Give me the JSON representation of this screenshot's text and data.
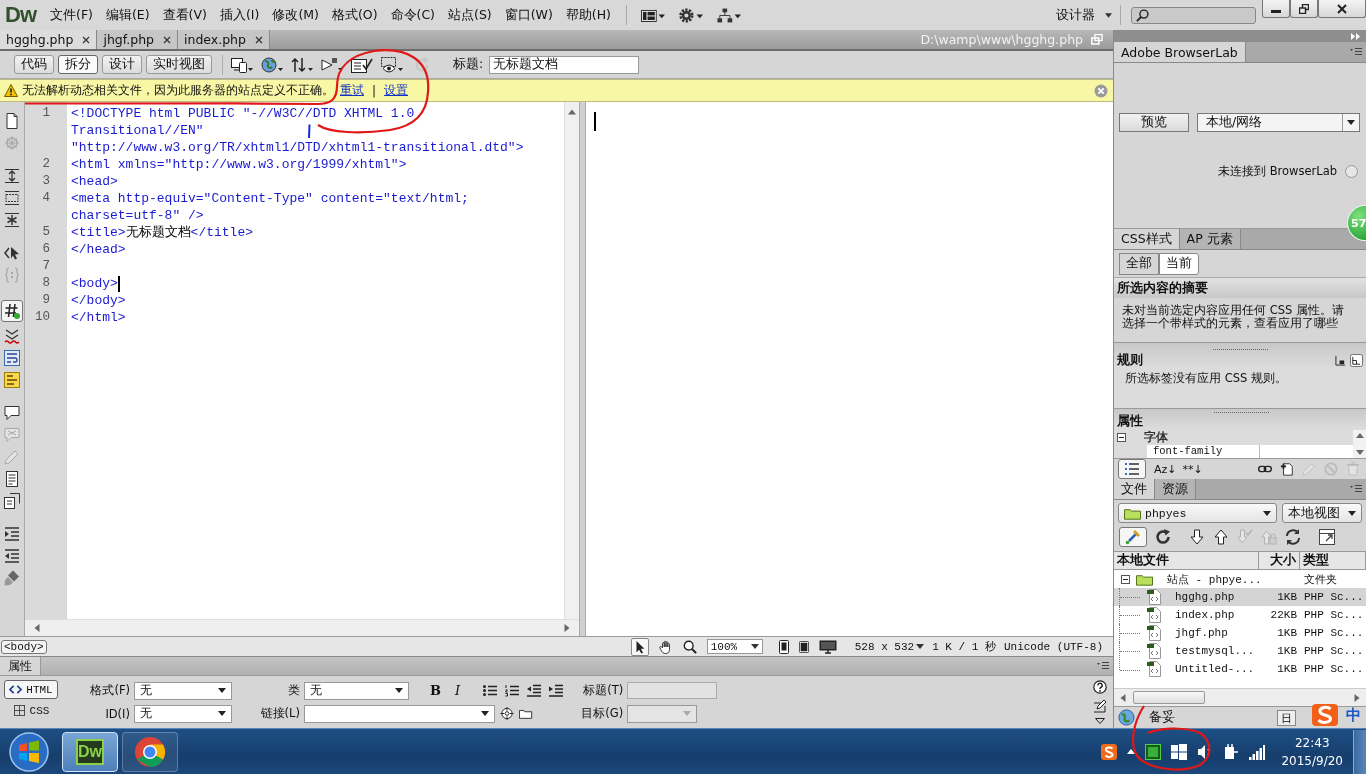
{
  "menu_bar": {
    "logo": "Dw",
    "menus": [
      "文件(F)",
      "编辑(E)",
      "查看(V)",
      "插入(I)",
      "修改(M)",
      "格式(O)",
      "命令(C)",
      "站点(S)",
      "窗口(W)",
      "帮助(H)"
    ],
    "workspace": "设计器"
  },
  "document_tabs": [
    {
      "label": "hgghg.php",
      "selected": true
    },
    {
      "label": "jhgf.php",
      "selected": false
    },
    {
      "label": "index.php",
      "selected": false
    }
  ],
  "file_path": "D:\\wamp\\www\\hgghg.php",
  "document_toolbar": {
    "views": [
      {
        "label": "代码",
        "selected": false
      },
      {
        "label": "拆分",
        "selected": true
      },
      {
        "label": "设计",
        "selected": false
      },
      {
        "label": "实时视图",
        "selected": false
      }
    ],
    "tools": [
      {
        "kind": "devices",
        "disabled": false
      },
      {
        "kind": "globe",
        "disabled": false
      },
      {
        "kind": "transfer",
        "disabled": false
      },
      {
        "kind": "debug",
        "disabled": false
      },
      {
        "kind": "validate",
        "disabled": false
      },
      {
        "kind": "visual",
        "disabled": false
      },
      {
        "kind": "refresh",
        "disabled": true
      }
    ],
    "title_label": "标题:",
    "title_value": "无标题文档"
  },
  "warning": {
    "message": "无法解析动态相关文件，因为此服务器的站点定义不正确。",
    "links": [
      "重试",
      "设置"
    ],
    "separator": "|"
  },
  "coding_toolbar": [
    {
      "kind": "documents",
      "on": false,
      "disabled": false
    },
    {
      "kind": "wheel",
      "on": false,
      "disabled": true
    },
    {
      "kind": "collapse",
      "on": false,
      "disabled": false
    },
    {
      "kind": "selection",
      "on": false,
      "disabled": false
    },
    {
      "kind": "expand",
      "on": false,
      "disabled": false
    },
    {
      "kind": "parent",
      "on": false,
      "disabled": false
    },
    {
      "kind": "braces",
      "on": false,
      "disabled": true
    },
    {
      "kind": "numbers",
      "on": true,
      "disabled": false
    },
    {
      "kind": "invalid",
      "on": false,
      "disabled": false
    },
    {
      "kind": "wrap",
      "on": false,
      "disabled": false
    },
    {
      "kind": "syntax",
      "on": false,
      "disabled": false
    },
    {
      "kind": "comment",
      "on": false,
      "disabled": false
    },
    {
      "kind": "uncomment",
      "on": false,
      "disabled": true
    },
    {
      "kind": "wraptag",
      "on": false,
      "disabled": true
    },
    {
      "kind": "snippets",
      "on": false,
      "disabled": false
    },
    {
      "kind": "move",
      "on": false,
      "disabled": false
    },
    {
      "kind": "indent",
      "on": false,
      "disabled": false
    },
    {
      "kind": "outdent",
      "on": false,
      "disabled": false
    },
    {
      "kind": "format",
      "on": false,
      "disabled": false
    }
  ],
  "code": [
    {
      "number": "1",
      "caret": false,
      "rows": [
        "<!DOCTYPE html PUBLIC \"-//W3C//DTD XHTML 1.0",
        "Transitional//EN\"",
        "\"http://www.w3.org/TR/xhtml1/DTD/xhtml1-transitional.dtd\">"
      ]
    },
    {
      "number": "2",
      "caret": false,
      "rows": [
        "<html xmlns=\"http://www.w3.org/1999/xhtml\">"
      ]
    },
    {
      "number": "3",
      "caret": false,
      "rows": [
        "<head>"
      ]
    },
    {
      "number": "4",
      "caret": false,
      "rows": [
        "<meta http-equiv=\"Content-Type\" content=\"text/html;",
        "charset=utf-8\" />"
      ]
    },
    {
      "number": "5",
      "caret": false,
      "rows": [
        [
          {
            "kind": "tag",
            "text": "<title>"
          },
          {
            "kind": "text",
            "text": "无标题文档"
          },
          {
            "kind": "tag",
            "text": "</title>"
          }
        ]
      ]
    },
    {
      "number": "6",
      "caret": false,
      "rows": [
        "</head>"
      ]
    },
    {
      "number": "7",
      "caret": false
    },
    {
      "number": "8",
      "caret": true,
      "rows": [
        "<body>"
      ]
    },
    {
      "number": "9",
      "caret": false,
      "rows": [
        "</body>"
      ]
    },
    {
      "number": "10",
      "caret": false,
      "rows": [
        "</html>"
      ]
    }
  ],
  "design_view": {
    "caret": true
  },
  "status_bar": {
    "tag": "<body>",
    "tools": [
      {
        "kind": "pointer",
        "selected": true
      },
      {
        "kind": "hand",
        "selected": false
      },
      {
        "kind": "zoom",
        "selected": false
      }
    ],
    "zoom": "100%",
    "window_size": "528 x 532",
    "download": "1 K / 1 秒",
    "encoding": "Unicode (UTF-8)"
  },
  "properties": {
    "title": "属性",
    "modes": [
      {
        "label": "HTML",
        "selected": true
      },
      {
        "label": "CSS",
        "selected": false
      }
    ],
    "format": {
      "label": "格式(F)",
      "value": "无"
    },
    "class": {
      "label": "类",
      "value": "无"
    },
    "id": {
      "label": "ID(I)",
      "value": "无"
    },
    "link": {
      "label": "链接(L)"
    },
    "bold": "B",
    "italic": "I",
    "heading": {
      "label": "标题(T)",
      "disabled": true
    },
    "target": {
      "label": "目标(G)",
      "disabled": true
    }
  },
  "browserlab": {
    "title": "Adobe BrowserLab",
    "preview": "预览",
    "source": "本地/网络",
    "status": "未连接到 BrowserLab",
    "connected": false
  },
  "css_panel": {
    "tabs": [
      {
        "label": "CSS样式",
        "selected": true
      },
      {
        "label": "AP 元素",
        "selected": false
      }
    ],
    "modes": [
      {
        "label": "全部",
        "selected": false
      },
      {
        "label": "当前",
        "selected": true
      }
    ],
    "summary_heading": "所选内容的摘要",
    "summary_lines": [
      "未对当前选定内容应用任何 CSS 属性。请",
      "选择一个带样式的元素，查看应用了哪些"
    ],
    "rules_heading": "规则",
    "rules_text": "所选标签没有应用 CSS 规则。",
    "properties_heading": "属性",
    "property_groups": [
      {
        "name": "字体",
        "expanded": true,
        "children": [
          {
            "name": "font-family"
          }
        ]
      }
    ],
    "view_tools": [
      {
        "kind": "list",
        "on": true
      }
    ],
    "sort_buttons": [
      "Az↓",
      "**↓"
    ],
    "tools": [
      {
        "kind": "link",
        "disabled": false
      },
      {
        "kind": "newrule",
        "disabled": false
      },
      {
        "kind": "edit",
        "disabled": true
      },
      {
        "kind": "disable",
        "disabled": true
      },
      {
        "kind": "delete",
        "disabled": true
      }
    ]
  },
  "files_panel": {
    "tabs": [
      {
        "label": "文件",
        "selected": true
      },
      {
        "label": "资源",
        "selected": false
      }
    ],
    "site": "phpyes",
    "view": "本地视图",
    "tools": [
      {
        "kind": "connect",
        "on": true,
        "disabled": false
      },
      {
        "kind": "reload",
        "on": false,
        "disabled": false
      },
      {
        "kind": "get",
        "on": false,
        "disabled": false
      },
      {
        "kind": "put",
        "on": false,
        "disabled": false
      },
      {
        "kind": "checkout",
        "on": false,
        "disabled": true
      },
      {
        "kind": "checkin",
        "on": false,
        "disabled": true
      },
      {
        "kind": "sync",
        "on": false,
        "disabled": false
      },
      {
        "kind": "expandwin",
        "on": false,
        "disabled": false
      }
    ],
    "columns": [
      "本地文件",
      "大小",
      "类型"
    ],
    "tree": [
      {
        "name": "站点 - phpye...",
        "type": "文件夹",
        "expanded": true,
        "selected": false,
        "children": [
          {
            "name": "hgghg.php",
            "size": "1KB",
            "type": "PHP Sc...",
            "selected": true
          },
          {
            "name": "index.php",
            "size": "22KB",
            "type": "PHP Sc...",
            "selected": false
          },
          {
            "name": "jhgf.php",
            "size": "1KB",
            "type": "PHP Sc...",
            "selected": false
          },
          {
            "name": "testmysql...",
            "size": "1KB",
            "type": "PHP Sc...",
            "selected": false
          },
          {
            "name": "Untitled-...",
            "size": "1KB",
            "type": "PHP Sc...",
            "selected": false
          }
        ]
      }
    ],
    "status": "备妥",
    "log_button": "日"
  },
  "taskbar": {
    "apps": [
      {
        "kind": "dreamweaver",
        "label": "Dw",
        "selected": true
      },
      {
        "kind": "chrome",
        "selected": false
      }
    ],
    "time": "22:43",
    "date": "2015/9/20"
  },
  "floating_badge": "57",
  "input_method": "中"
}
